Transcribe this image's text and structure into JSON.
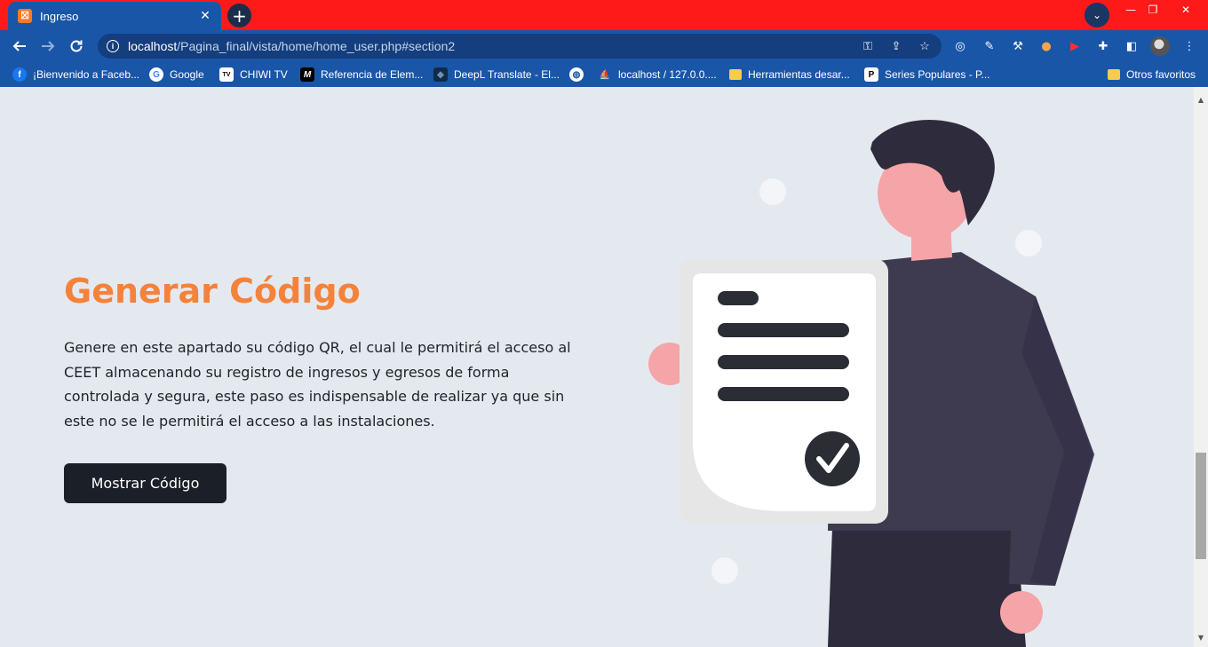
{
  "browser": {
    "tab": {
      "title": "Ingreso",
      "favicon_letter": "⛝"
    },
    "new_tab": "+",
    "window_controls": {
      "minimize": "—",
      "restore": "❐",
      "close": "✕"
    },
    "url": {
      "host": "localhost",
      "path": "/Pagina_final/vista/home/home_user.php#section2"
    },
    "bookmarks": [
      {
        "label": "¡Bienvenido a Faceb...",
        "icon": "facebook-icon",
        "color": "#1877f2",
        "glyph": "f"
      },
      {
        "label": "Google",
        "icon": "google-icon",
        "color": "#ffffff",
        "glyph": "G"
      },
      {
        "label": "CHIWI TV",
        "icon": "tv-icon",
        "color": "#ffffff",
        "glyph": "TV"
      },
      {
        "label": "Referencia de Elem...",
        "icon": "mdn-icon",
        "color": "#000000",
        "glyph": "M"
      },
      {
        "label": "DeepL Translate - El...",
        "icon": "deepl-icon",
        "color": "#0f2b46",
        "glyph": "◆"
      },
      {
        "label": "",
        "icon": "globe-icon",
        "color": "#ffffff",
        "glyph": "◍"
      },
      {
        "label": "localhost / 127.0.0....",
        "icon": "phpmyadmin-icon",
        "color": "#f29111",
        "glyph": "⛵"
      },
      {
        "label": "Herramientas desar...",
        "icon": "folder-icon",
        "color": "#f7cb4d",
        "glyph": ""
      },
      {
        "label": "Series Populares - P...",
        "icon": "p-icon",
        "color": "#ffffff",
        "glyph": "P"
      }
    ],
    "other_bookmarks": "Otros favoritos"
  },
  "section": {
    "heading": "Generar Código",
    "body": "Genere en este apartado su código QR, el cual le permitirá el acceso al CEET almacenando su registro de ingresos y egresos de forma controlada y segura, este paso es indispensable de realizar ya que sin este no se le permitirá el acceso a las instalaciones.",
    "button_label": "Mostrar Código"
  },
  "colors": {
    "accent": "#f5823a",
    "button_bg": "#1b1f27",
    "page_bg": "#e4e9f0",
    "chrome_tabbar": "#ff1a1a",
    "chrome_toolbar": "#1a56a8"
  }
}
